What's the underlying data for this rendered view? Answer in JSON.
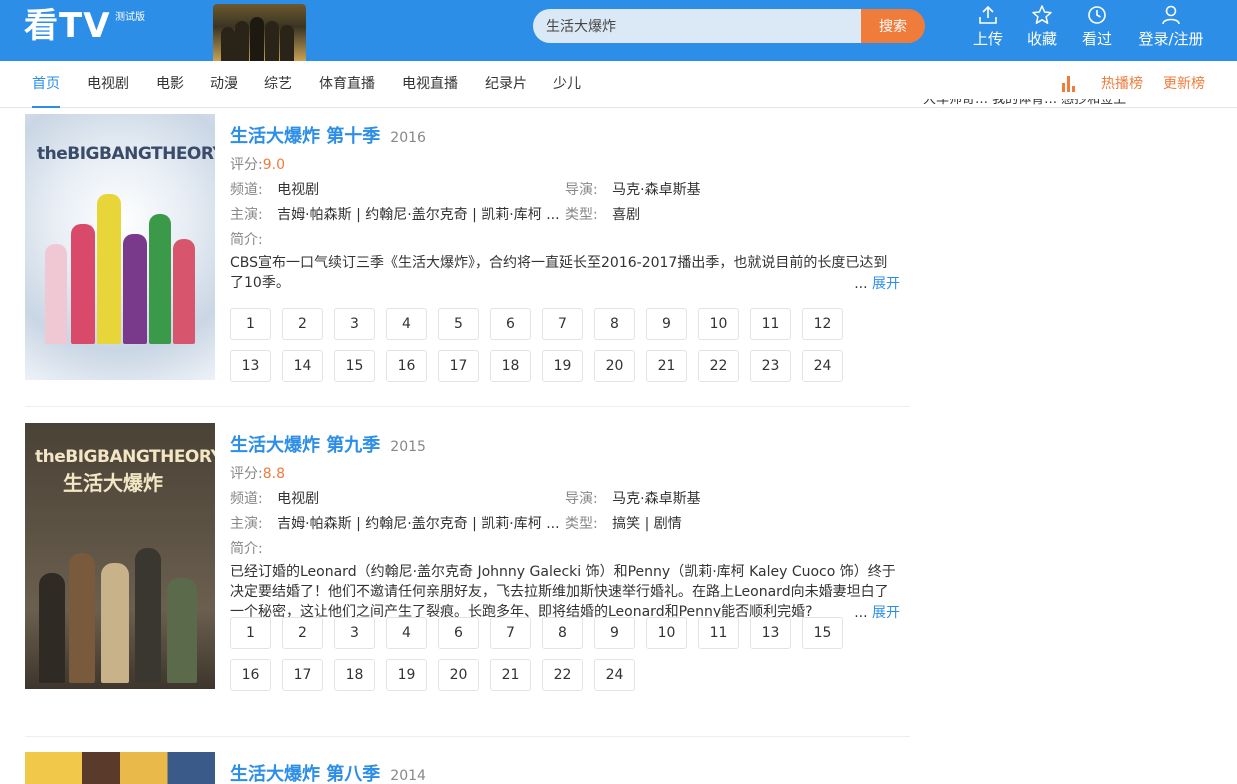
{
  "header": {
    "logo": "看TV",
    "logo_badge": "测试版",
    "search_value": "生活大爆炸",
    "search_button": "搜索",
    "actions": [
      {
        "label": "上传",
        "icon": "upload-icon"
      },
      {
        "label": "收藏",
        "icon": "star-icon"
      },
      {
        "label": "看过",
        "icon": "history-icon"
      },
      {
        "label": "登录/注册",
        "icon": "user-icon"
      }
    ]
  },
  "nav": {
    "items": [
      "首页",
      "电视剧",
      "电影",
      "动漫",
      "综艺",
      "体育直播",
      "电视直播",
      "纪录片",
      "少儿"
    ],
    "active_index": 0,
    "hot_rank": "热播榜",
    "update_rank": "更新榜"
  },
  "side_text": "大车师奇…   我的体育…   感抄和签上",
  "labels": {
    "score": "评分:",
    "channel": "频道:",
    "director": "导演:",
    "cast": "主演:",
    "genre": "类型:",
    "intro": "简介:",
    "expand": "展开",
    "ellipsis": "..."
  },
  "results": [
    {
      "title": "生活大爆炸 第十季",
      "year": "2016",
      "score": "9.0",
      "channel": "电视剧",
      "director": "马克·森卓斯基",
      "cast": "吉姆·帕森斯 | 约翰尼·盖尔克奇 | 凯莉·库柯 ...",
      "genre": "喜剧",
      "desc": "CBS宣布一口气续订三季《生活大爆炸》，合约将一直延长至2016-2017播出季，也就说目前的长度已达到了10季。",
      "episodes": [
        "1",
        "2",
        "3",
        "4",
        "5",
        "6",
        "7",
        "8",
        "9",
        "10",
        "11",
        "12",
        "13",
        "14",
        "15",
        "16",
        "17",
        "18",
        "19",
        "20",
        "21",
        "22",
        "23",
        "24"
      ]
    },
    {
      "title": "生活大爆炸 第九季",
      "year": "2015",
      "score": "8.8",
      "channel": "电视剧",
      "director": "马克·森卓斯基",
      "cast": "吉姆·帕森斯 | 约翰尼·盖尔克奇 | 凯莉·库柯 ...",
      "genre": "搞笑 | 剧情",
      "desc": "已经订婚的Leonard（约翰尼·盖尔克奇 Johnny Galecki 饰）和Penny（凯莉·库柯 Kaley Cuoco 饰）终于决定要结婚了！他们不邀请任何亲朋好友，飞去拉斯维加斯快速举行婚礼。在路上Leonard向未婚妻坦白了一个秘密，这让他们之间产生了裂痕。长跑多年、即将结婚的Leonard和Penny能否顺利完婚?",
      "episodes": [
        "1",
        "2",
        "3",
        "4",
        "6",
        "7",
        "8",
        "9",
        "10",
        "11",
        "13",
        "15",
        "16",
        "17",
        "18",
        "19",
        "20",
        "21",
        "22",
        "24"
      ]
    },
    {
      "title": "生活大爆炸 第八季",
      "year": "2014"
    }
  ],
  "poster_texts": [
    "theBIGBANGTHEORY",
    "theBIGBANGTHEORY",
    "生活大爆炸"
  ],
  "colors": {
    "header_bg": "#2d8ee8",
    "accent": "#2d8ee8",
    "orange": "#f07c3b"
  }
}
